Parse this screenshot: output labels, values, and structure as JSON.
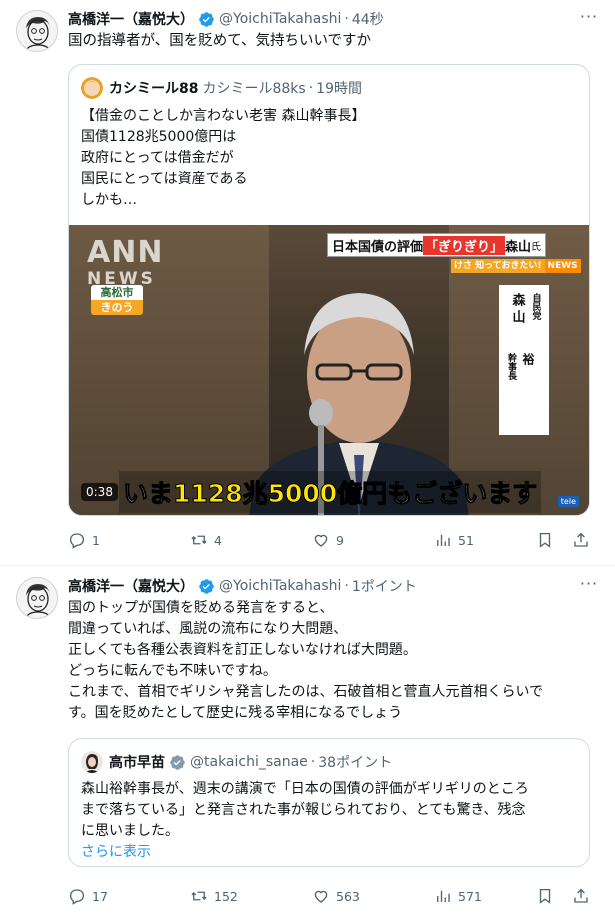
{
  "tweet1": {
    "author_name": "高橋洋一（嘉悦大）",
    "handle": "@YoichiTakahashi",
    "time": "44秒",
    "text": "国の指導者が、国を貶めて、気持ちいいですか",
    "quote": {
      "author_name": "カシミール88",
      "handle": "カシミール88ks",
      "time": "19時間",
      "lines": [
        "【借金のことしか言わない老害 森山幹事長】",
        "国債1128兆5000億円は",
        "政府にとっては借金だが",
        "国民にとっては資産である",
        "しかも…"
      ],
      "video": {
        "logo_main": "ANN",
        "logo_sub": "NEWS",
        "location_top": "高松市",
        "location_bottom": "きのう",
        "headline_part1": "日本国債の評価",
        "headline_highlight": "「ぎりぎり」",
        "headline_part3": "森山",
        "headline_suffix": "氏",
        "ticker_left": "けさ 知っておきたい!",
        "ticker_right": "NEWS",
        "name_party": "自民党",
        "name_surname": "森山",
        "name_given": "裕",
        "name_title": "幹事長",
        "duration": "0:38",
        "caption_pre": "いま",
        "caption_num": "1128兆5000億円",
        "caption_post": "もございます",
        "corner_logo": "tele"
      }
    },
    "stats": {
      "replies": "1",
      "reposts": "4",
      "likes": "9",
      "views": "51"
    }
  },
  "tweet2": {
    "author_name": "高橋洋一（嘉悦大）",
    "handle": "@YoichiTakahashi",
    "time": "1ポイント",
    "lines": [
      "国のトップが国債を貶める発言をすると、",
      "間違っていれば、風説の流布になり大問題、",
      "正しくても各種公表資料を訂正しないなければ大問題。",
      "どっちに転んでも不味いですね。",
      "これまで、首相でギリシャ発言したのは、石破首相と菅直人元首相くらいで",
      "す。国を貶めたとして歴史に残る宰相になるでしょう"
    ],
    "quote": {
      "author_name": "高市早苗",
      "handle": "@takaichi_sanae",
      "time": "38ポイント",
      "lines": [
        "森山裕幹事長が、週末の講演で「日本の国債の評価がギリギリのところ",
        "まで落ちている」と発言された事が報じられており、とても驚き、残念",
        "に思いました。"
      ],
      "show_more": "さらに表示"
    },
    "stats": {
      "replies": "17",
      "reposts": "152",
      "likes": "563",
      "views": "571"
    }
  },
  "colors": {
    "verified": "#1d9bf0",
    "link": "#1d9bf0",
    "muted": "#536471",
    "caption_yellow": "#ffe600",
    "ticker_orange": "#ff8a00"
  },
  "icons": [
    "verified-badge-icon",
    "more-icon",
    "reply-icon",
    "repost-icon",
    "like-icon",
    "views-icon",
    "bookmark-icon",
    "share-icon"
  ]
}
